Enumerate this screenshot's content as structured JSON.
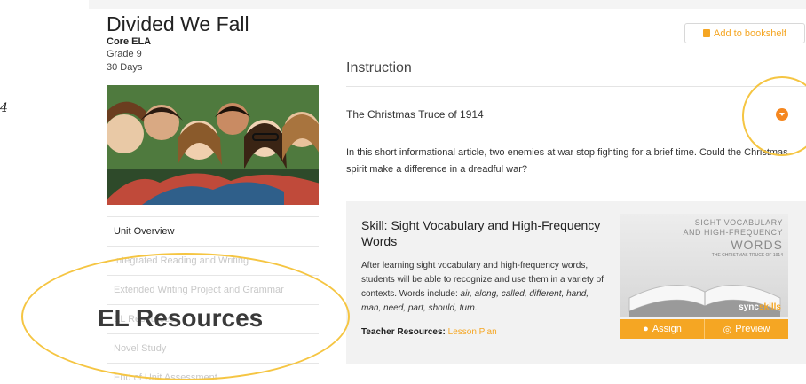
{
  "margin_mark": "4",
  "unit": {
    "title": "Divided We Fall",
    "course": "Core ELA",
    "grade": "Grade 9",
    "duration": "30 Days"
  },
  "nav": {
    "items": [
      {
        "label": "Unit Overview"
      },
      {
        "label": "Integrated Reading and Writing"
      },
      {
        "label": "Extended Writing Project and Grammar"
      },
      {
        "label": "EL Resources"
      },
      {
        "label": "Novel Study"
      },
      {
        "label": "End of Unit Assessment"
      }
    ]
  },
  "header": {
    "bookshelf_label": "Add to bookshelf",
    "section": "Instruction"
  },
  "lesson": {
    "title": "The Christmas Truce of 1914",
    "description": "In this short informational article, two enemies at war stop fighting for a brief time. Could the Christmas spirit make a difference in a dreadful war?"
  },
  "skill": {
    "title": "Skill: Sight Vocabulary and High-Frequency Words",
    "description_intro": "After learning sight vocabulary and high-frequency words, students will be able to recognize and use them in a variety of contexts. Words include: ",
    "description_words": "air, along, called, different, hand, man, need, part, should, turn.",
    "teacher_label": "Teacher Resources:",
    "teacher_link": "Lesson Plan",
    "cover": {
      "line1": "SIGHT VOCABULARY",
      "line2": "AND HIGH-FREQUENCY",
      "line3": "WORDS",
      "line4": "THE CHRISTMAS TRUCE OF 1914",
      "brand_a": "sync",
      "brand_b": "skills"
    },
    "assign_label": "Assign",
    "preview_label": "Preview"
  },
  "callout": {
    "label": "EL Resources"
  },
  "colors": {
    "accent": "#f5a623",
    "highlight_ring": "#f5c542"
  }
}
